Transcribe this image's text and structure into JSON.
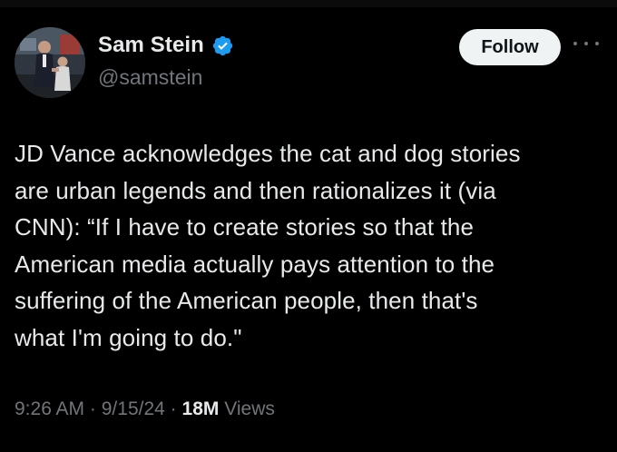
{
  "author": {
    "display_name": "Sam Stein",
    "handle": "@samstein",
    "verified_icon": "verified-badge-icon",
    "verified_color": "#1d9bf0"
  },
  "follow": {
    "label": "Follow"
  },
  "more": {
    "icon": "more-dots-icon"
  },
  "tweet": {
    "text": "JD Vance acknowledges the cat and dog stories\nare urban legends and then rationalizes it (via\nCNN): “If I have to create stories so that the\nAmerican media actually pays attention to the\nsuffering of the American people, then that's\nwhat I'm going to do.\""
  },
  "meta": {
    "time": "9:26 AM",
    "sep1": "·",
    "date": "9/15/24",
    "sep2": "·",
    "views_count": "18M",
    "views_label": "Views"
  },
  "colors": {
    "background": "#000000",
    "primary_text": "#e7e9ea",
    "secondary_text": "#71767b",
    "follow_bg": "#eff3f4"
  }
}
